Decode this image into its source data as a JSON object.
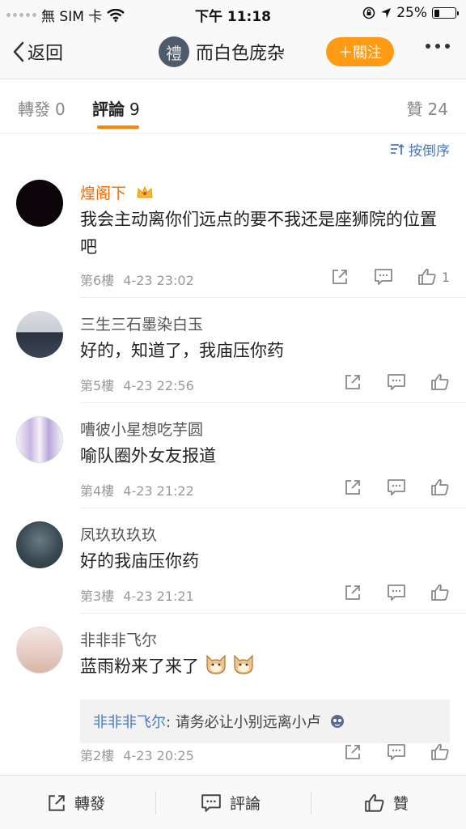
{
  "status": {
    "carrier": "無 SIM 卡",
    "time": "下午 11:18",
    "battery": "25%"
  },
  "nav": {
    "back_label": "返回",
    "avatar_char": "禮",
    "title": "而白色庞杂",
    "follow_label": "＋關注"
  },
  "tabs": [
    {
      "label": "轉發",
      "count": "0"
    },
    {
      "label": "評論",
      "count": "9"
    },
    {
      "label": "贊",
      "count": "24"
    }
  ],
  "sort_label": "按倒序",
  "comments": [
    {
      "name": "煌阁下",
      "text": "我会主动离你们远点的要不我还是座狮院的位置吧",
      "floor": "第6樓",
      "time": "4-23 23:02",
      "likes": "1"
    },
    {
      "name": "三生三石墨染白玉",
      "text": "好的，知道了，我庙压你药",
      "floor": "第5樓",
      "time": "4-23 22:56",
      "likes": ""
    },
    {
      "name": "嘈彼小星想吃芋圆",
      "text": "喻队圈外女友报道",
      "floor": "第4樓",
      "time": "4-23 21:22",
      "likes": ""
    },
    {
      "name": "凤玖玖玖玖",
      "text": "好的我庙压你药",
      "floor": "第3樓",
      "time": "4-23 21:21",
      "likes": ""
    },
    {
      "name": "非非非飞尔",
      "text": "蓝雨粉来了来了",
      "floor": "第2樓",
      "time": "4-23 20:25",
      "likes": "",
      "reply": {
        "name": "非非非飞尔",
        "sep": ": ",
        "text": "请务必让小别远离小卢"
      }
    }
  ],
  "bottom": {
    "repost_label": "轉發",
    "comment_label": "評論",
    "like_label": "贊"
  },
  "colors": {
    "accent": "#ff8200",
    "follow": "#ff9a14",
    "link": "#4d7ab8",
    "vip_name": "#f06b08"
  }
}
